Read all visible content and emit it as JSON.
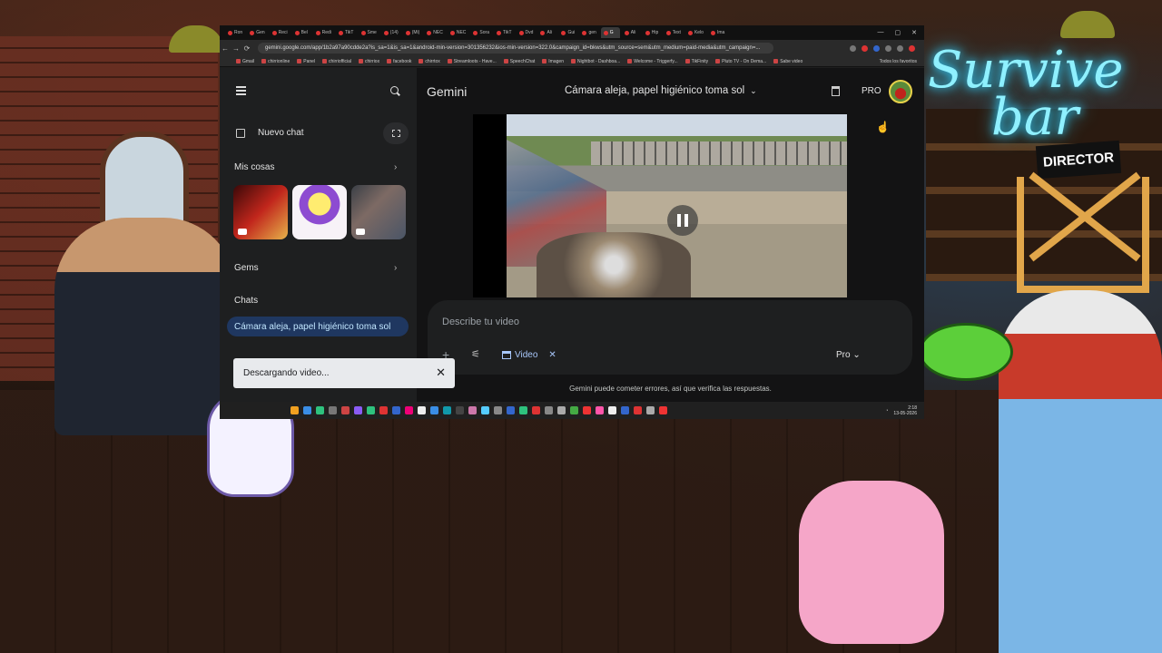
{
  "browser": {
    "tabs": [
      "Ron",
      "Gen",
      "Reci",
      "Bel",
      "Redi",
      "TikT",
      "Sme",
      "(14)",
      "(Mi)",
      "NEC",
      "NEC",
      "Sora",
      "TikT",
      "Dvd",
      "Ali",
      "Gui",
      "gen",
      "G",
      "Ali",
      "Hip",
      "Text",
      "Kelo",
      "Ima"
    ],
    "active_tab_index": 17,
    "url": "gemini.google.com/app/1b2a97a90cdde2a?is_sa=1&is_sa=1&android-min-version=301356232&ios-min-version=322.0&campaign_id=bkws&utm_source=sem&utm_medium=paid-media&utm_campaign=...",
    "bookmarks": [
      "Gmail",
      "chirrionline",
      "Panel",
      "chirriofficial",
      "chirriox",
      "facebook",
      "chirrtox",
      "Streamloots - Have...",
      "SpeechChat",
      "Imagen",
      "Nightbot - Dashboa...",
      "Welcome - Triggerfy...",
      "TikFinity",
      "Pluto TV - On Dema...",
      "Sabe video"
    ],
    "bookmarks_right": "Todos los favoritos"
  },
  "gemini": {
    "brand": "Gemini",
    "new_chat": "Nuevo chat",
    "my_stuff": "Mis cosas",
    "gems": "Gems",
    "chats": "Chats",
    "active_chat": "Cámara aleja, papel higiénico toma sol",
    "conversation_title": "Cámara aleja, papel higiénico toma sol",
    "plan": "PRO",
    "composer_placeholder": "Describe tu video",
    "tool_chip": "Video",
    "model_label": "Pro",
    "disclaimer": "Gemini puede cometer errores, así que verifica las respuestas.",
    "toast": "Descargando video..."
  },
  "taskbar": {
    "time": "2:18",
    "date": "13-05-2026"
  },
  "overlay": {
    "neon_line1": "Survive",
    "neon_line2": "bar",
    "sign": "DIRECTOR"
  },
  "icons": [
    "menu-icon",
    "search-icon",
    "edit-icon",
    "new-window-icon",
    "chevron-right-icon",
    "play-icon",
    "chevron-down-icon",
    "trash-icon",
    "share-icon",
    "pause-icon",
    "plus-icon",
    "tune-icon",
    "calendar-icon",
    "close-icon",
    "cursor-icon"
  ],
  "colors": {
    "sidebar_bg": "#1e1f20",
    "main_bg": "#131314",
    "active_chat_bg": "#1f3760",
    "accent_blue": "#a8c7fa"
  }
}
